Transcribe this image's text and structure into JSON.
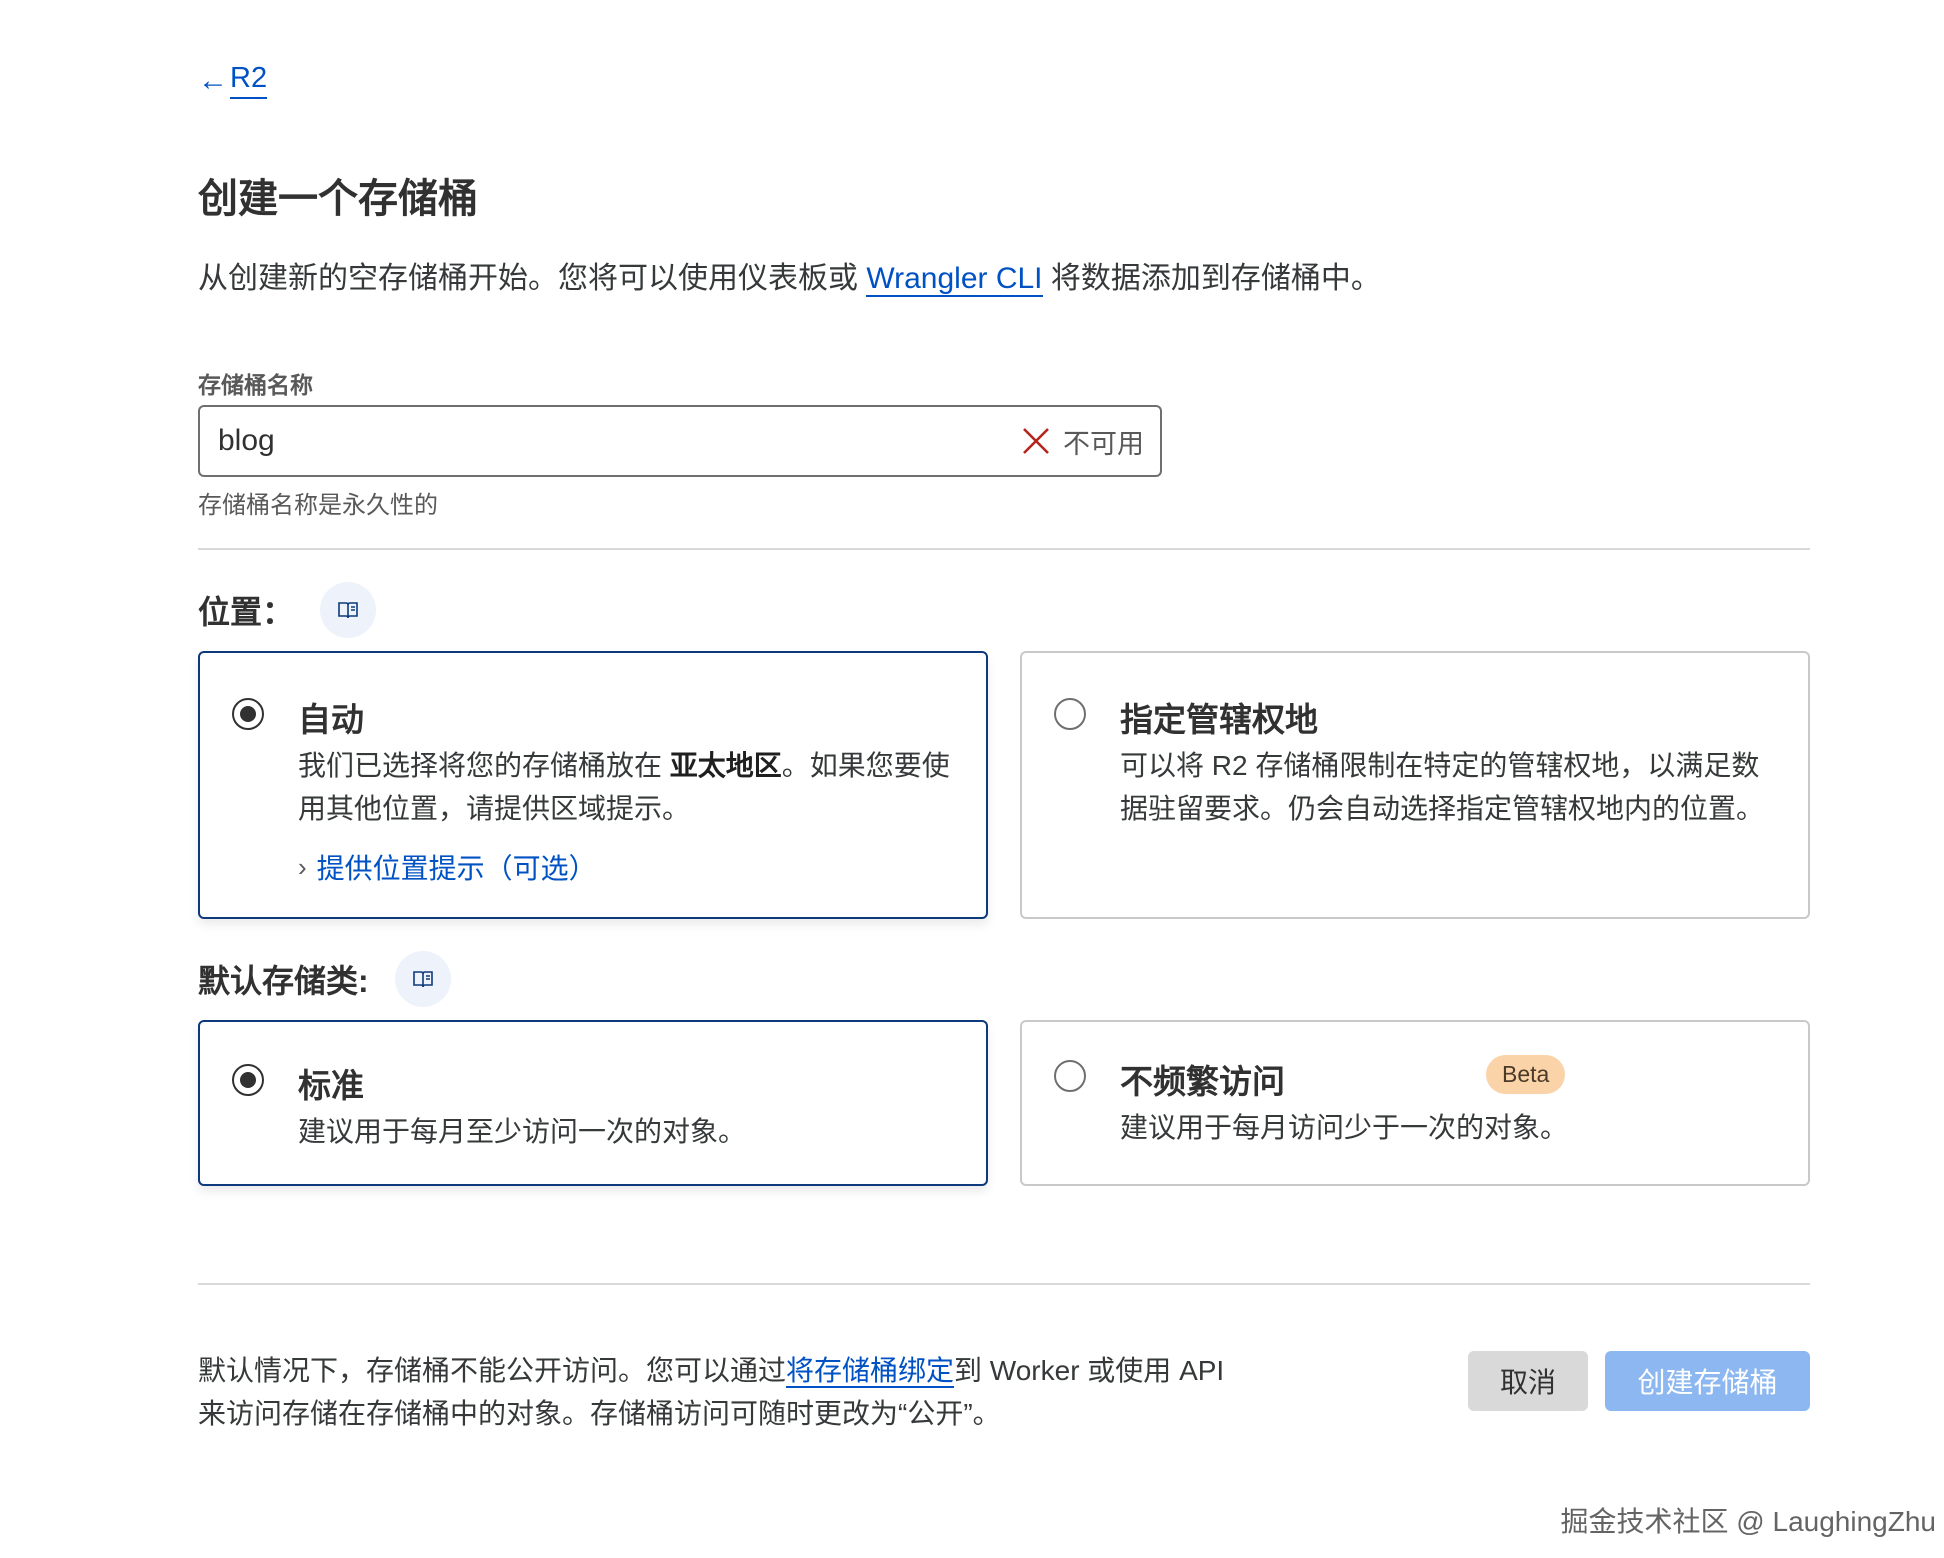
{
  "nav": {
    "back_arrow": "←",
    "back_label": "R2"
  },
  "page": {
    "title": "创建一个存储桶",
    "intro_before": "从创建新的空存储桶开始。您将可以使用仪表板或 ",
    "intro_link": "Wrangler CLI",
    "intro_after": " 将数据添加到存储桶中。"
  },
  "bucket_name": {
    "label": "存储桶名称",
    "value": "blog",
    "status_icon": "x-icon",
    "status": "不可用",
    "hint": "存储桶名称是永久性的"
  },
  "location": {
    "title": "位置：",
    "doc_icon": "book-icon",
    "options": [
      {
        "title": "自动",
        "selected": true,
        "desc_before": "我们已选择将您的存储桶放在 ",
        "desc_bold": "亚太地区",
        "desc_after": "。如果您要使",
        "desc_line2": "用其他位置，请提供区域提示。",
        "link": "提供位置提示（可选）"
      },
      {
        "title": "指定管辖权地",
        "selected": false,
        "desc_line1": "可以将 R2 存储桶限制在特定的管辖权地，以满足数",
        "desc_line2": "据驻留要求。仍会自动选择指定管辖权地内的位置。"
      }
    ]
  },
  "storage_class": {
    "title": "默认存储类:",
    "doc_icon": "book-icon",
    "options": [
      {
        "title": "标准",
        "selected": true,
        "desc": "建议用于每月至少访问一次的对象。"
      },
      {
        "title": "不频繁访问",
        "selected": false,
        "badge": "Beta",
        "desc": "建议用于每月访问少于一次的对象。"
      }
    ]
  },
  "footer": {
    "text_before": "默认情况下，存储桶不能公开访问。您可以通过",
    "text_link": "将存储桶绑定",
    "text_after": "到 Worker 或使用 API",
    "text_line2": "来访问存储在存储桶中的对象。存储桶访问可随时更改为“公开”。",
    "cancel_label": "取消",
    "create_label": "创建存储桶"
  },
  "watermark": "掘金技术社区 @ LaughingZhu",
  "colors": {
    "accent": "#0051c3",
    "selected_border": "#0d3a7d",
    "error_x": "#b3261e",
    "create_disabled": "#8db7f0"
  }
}
